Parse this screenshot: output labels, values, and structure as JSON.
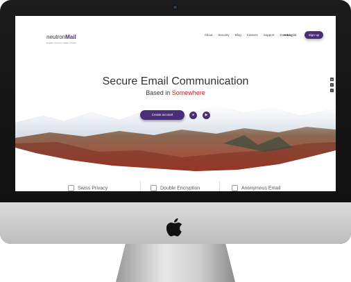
{
  "app": {
    "logo_regular": "neutron",
    "logo_bold": "Mail",
    "languages": "English  |  French  |  Italian  |  Polish"
  },
  "nav": {
    "items": [
      "About",
      "Security",
      "Blog",
      "Careers",
      "Support",
      "Donate"
    ],
    "login_label": "Log in",
    "signup_label": "Sign up"
  },
  "hero": {
    "title": "Secure Email Communication",
    "subtitle_prefix": "Based in ",
    "subtitle_highlight": "Somewhere",
    "cta_label": "Create account",
    "highlight_color": "#b3262e",
    "brand_color": "#4a2f78"
  },
  "social": [
    "in",
    "f",
    "t"
  ],
  "features": [
    {
      "label": "Swiss Privacy",
      "icon": "shield-icon"
    },
    {
      "label": "Double Encryption",
      "icon": "lock-icon"
    },
    {
      "label": "Anonymous Email",
      "icon": "anonymous-icon"
    }
  ]
}
